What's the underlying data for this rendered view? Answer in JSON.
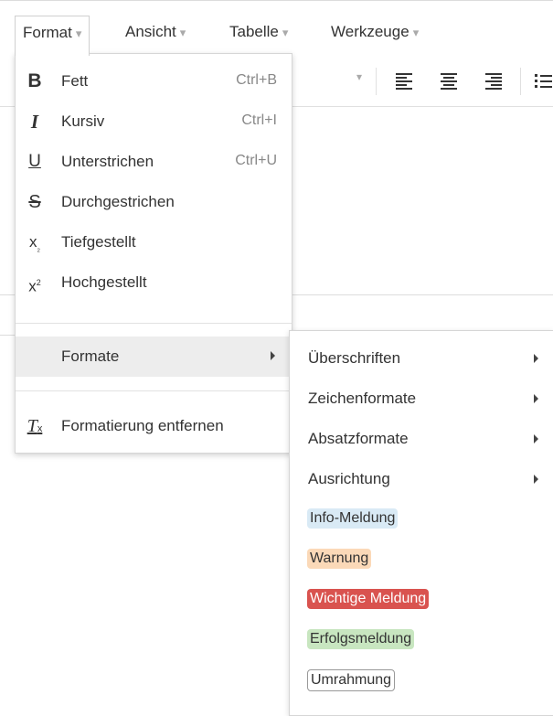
{
  "menubar": {
    "items": [
      {
        "label": "Format",
        "caret": "▾"
      },
      {
        "label": "Ansicht",
        "caret": "▾"
      },
      {
        "label": "Tabelle",
        "caret": "▾"
      },
      {
        "label": "Werkzeuge",
        "caret": "▾"
      }
    ]
  },
  "format_menu": {
    "items": [
      {
        "icon": "bold-icon",
        "label": "Fett",
        "shortcut": "Ctrl+B"
      },
      {
        "icon": "italic-icon",
        "label": "Kursiv",
        "shortcut": "Ctrl+I"
      },
      {
        "icon": "underline-icon",
        "label": "Unterstrichen",
        "shortcut": "Ctrl+U"
      },
      {
        "icon": "strikethrough-icon",
        "label": "Durchgestrichen",
        "shortcut": ""
      },
      {
        "icon": "subscript-icon",
        "label": "Tiefgestellt",
        "shortcut": ""
      },
      {
        "icon": "superscript-icon",
        "label": "Hochgestellt",
        "shortcut": ""
      }
    ],
    "formats_label": "Formate",
    "clear_label": "Formatierung entfernen"
  },
  "formats_submenu": {
    "items": [
      {
        "label": "Überschriften"
      },
      {
        "label": "Zeichenformate"
      },
      {
        "label": "Absatzformate"
      },
      {
        "label": "Ausrichtung"
      }
    ],
    "badges": [
      {
        "label": "Info-Meldung",
        "bg": "#d9eaf5",
        "fg": "#333333",
        "border": "none"
      },
      {
        "label": "Warnung",
        "bg": "#fbd9b8",
        "fg": "#333333",
        "border": "none"
      },
      {
        "label": "Wichtige Meldung",
        "bg": "#d9534f",
        "fg": "#ffffff",
        "border": "none"
      },
      {
        "label": "Erfolgsmeldung",
        "bg": "#c8e6c0",
        "fg": "#333333",
        "border": "none"
      },
      {
        "label": "Umrahmung",
        "bg": "#ffffff",
        "fg": "#333333",
        "border": "1px solid #999999"
      }
    ]
  }
}
